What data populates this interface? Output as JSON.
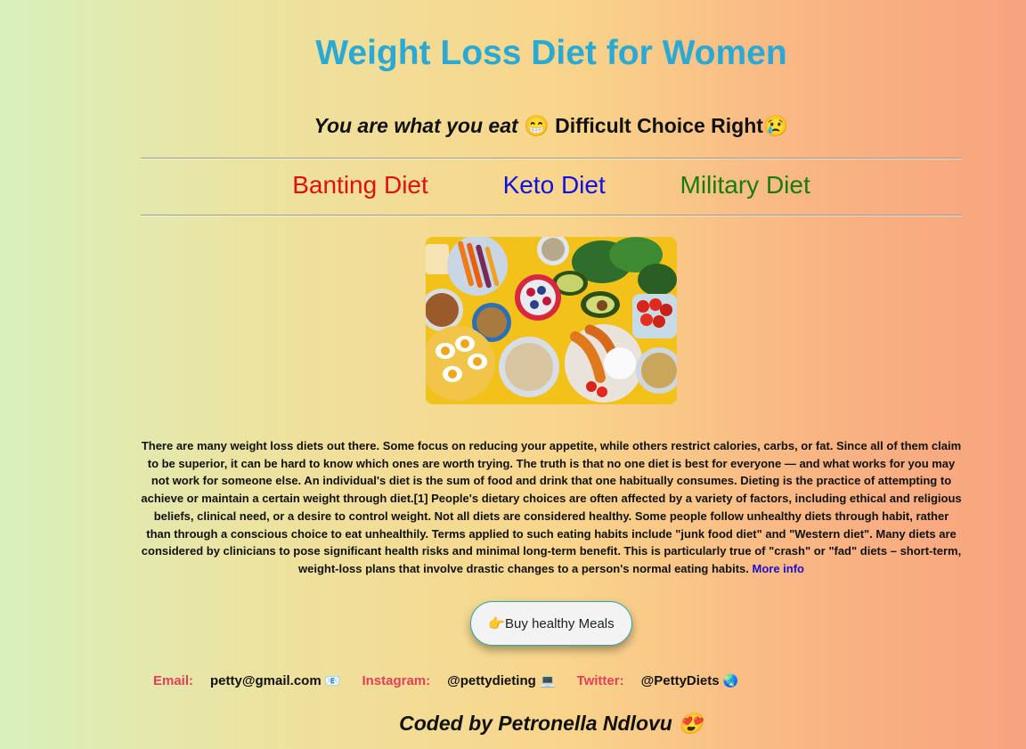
{
  "header": {
    "title": "Weight Loss Diet for Women",
    "tagline": "You are what you eat",
    "tagline_emoji": "😁",
    "subtitle_rest": "Difficult Choice Right",
    "subtitle_emoji": "😢"
  },
  "nav": {
    "items": [
      {
        "label": "Banting Diet",
        "color": "#e01010"
      },
      {
        "label": "Keto Diet",
        "color": "#1010e0"
      },
      {
        "label": "Military Diet",
        "color": "#1a7a10"
      }
    ]
  },
  "photo": {
    "icon": "healthy-food-image"
  },
  "article": {
    "text": "There are many weight loss diets out there. Some focus on reducing your appetite, while others restrict calories, carbs, or fat. Since all of them claim to be superior, it can be hard to know which ones are worth trying. The truth is that no one diet is best for everyone — and what works for you may not work for someone else. An individual's diet is the sum of food and drink that one habitually consumes. Dieting is the practice of attempting to achieve or maintain a certain weight through diet.[1] People's dietary choices are often affected by a variety of factors, including ethical and religious beliefs, clinical need, or a desire to control weight. Not all diets are considered healthy. Some people follow unhealthy diets through habit, rather than through a conscious choice to eat unhealthily. Terms applied to such eating habits include \"junk food diet\" and \"Western diet\". Many diets are considered by clinicians to pose significant health risks and minimal long-term benefit. This is particularly true of \"crash\" or \"fad\" diets – short-term, weight-loss plans that involve drastic changes to a person's normal eating habits.",
    "link_label": "More info"
  },
  "cta": {
    "label": "👉Buy healthy Meals"
  },
  "contacts": {
    "email_label": "Email:",
    "email_value": "petty@gmail.com",
    "email_emoji": "📧",
    "instagram_label": "Instagram:",
    "instagram_value": "@pettydieting",
    "instagram_emoji": "💻",
    "twitter_label": "Twitter:",
    "twitter_value": "@PettyDiets",
    "twitter_emoji": "🌏"
  },
  "footer": {
    "credit": "Coded by Petronella Ndlovu",
    "emoji": "😍"
  },
  "colors": {
    "title": "#2aa9d4",
    "contact_label": "#e0405a",
    "link": "#1a0dcc"
  }
}
